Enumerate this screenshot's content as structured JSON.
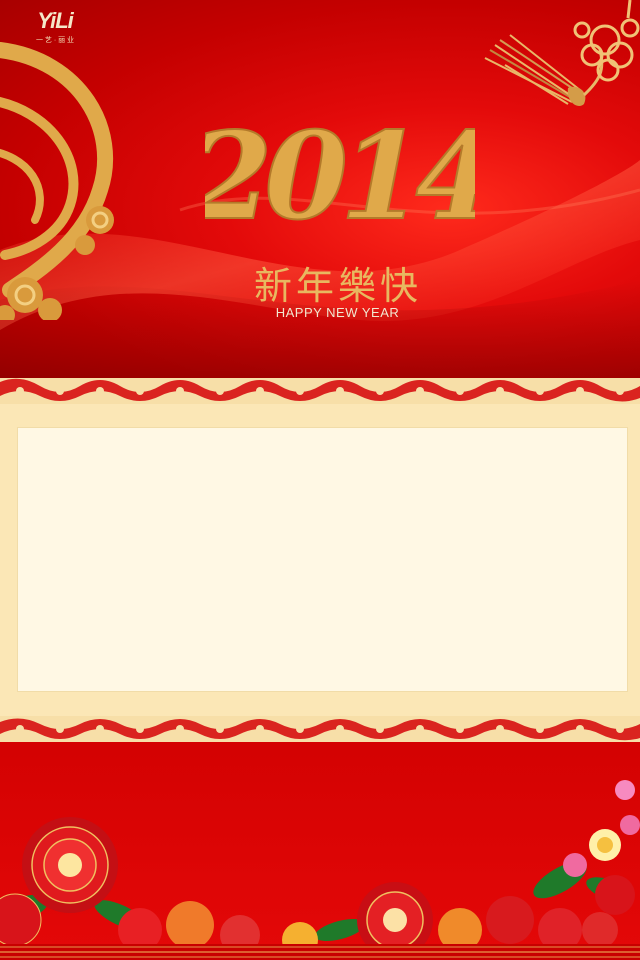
{
  "logo": {
    "text": "YiLi",
    "subtext": "一 艺 · 丽 业"
  },
  "year": "2014",
  "greeting_cn": "新年樂快",
  "greeting_en": "HAPPY NEW YEAR",
  "colors": {
    "primary_red": "#d80000",
    "gold": "#e0a94a",
    "cream": "#fbe7b6",
    "panel": "#fff8e4"
  },
  "icons": [
    "gold-cloud-swirl-icon",
    "chinese-knot-tassel-icon",
    "peony-flower-icon",
    "lotus-flower-icon"
  ]
}
